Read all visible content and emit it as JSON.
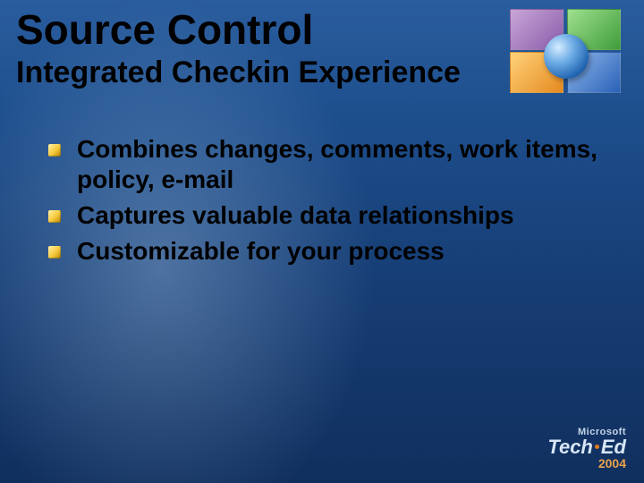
{
  "title": "Source Control",
  "subtitle": "Integrated Checkin Experience",
  "bullets": [
    "Combines changes, comments, work items, policy, e-mail",
    "Captures valuable data relationships",
    "Customizable for your process"
  ],
  "footer": {
    "brand": "Microsoft",
    "event_a": "Tech",
    "event_b": "Ed",
    "year": "2004"
  }
}
